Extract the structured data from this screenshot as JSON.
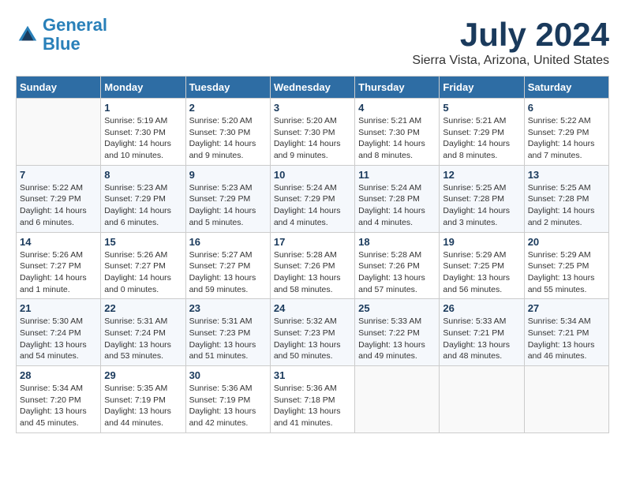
{
  "logo": {
    "line1": "General",
    "line2": "Blue"
  },
  "title": "July 2024",
  "location": "Sierra Vista, Arizona, United States",
  "days_of_week": [
    "Sunday",
    "Monday",
    "Tuesday",
    "Wednesday",
    "Thursday",
    "Friday",
    "Saturday"
  ],
  "weeks": [
    [
      {
        "day": "",
        "info": ""
      },
      {
        "day": "1",
        "info": "Sunrise: 5:19 AM\nSunset: 7:30 PM\nDaylight: 14 hours\nand 10 minutes."
      },
      {
        "day": "2",
        "info": "Sunrise: 5:20 AM\nSunset: 7:30 PM\nDaylight: 14 hours\nand 9 minutes."
      },
      {
        "day": "3",
        "info": "Sunrise: 5:20 AM\nSunset: 7:30 PM\nDaylight: 14 hours\nand 9 minutes."
      },
      {
        "day": "4",
        "info": "Sunrise: 5:21 AM\nSunset: 7:30 PM\nDaylight: 14 hours\nand 8 minutes."
      },
      {
        "day": "5",
        "info": "Sunrise: 5:21 AM\nSunset: 7:29 PM\nDaylight: 14 hours\nand 8 minutes."
      },
      {
        "day": "6",
        "info": "Sunrise: 5:22 AM\nSunset: 7:29 PM\nDaylight: 14 hours\nand 7 minutes."
      }
    ],
    [
      {
        "day": "7",
        "info": "Sunrise: 5:22 AM\nSunset: 7:29 PM\nDaylight: 14 hours\nand 6 minutes."
      },
      {
        "day": "8",
        "info": "Sunrise: 5:23 AM\nSunset: 7:29 PM\nDaylight: 14 hours\nand 6 minutes."
      },
      {
        "day": "9",
        "info": "Sunrise: 5:23 AM\nSunset: 7:29 PM\nDaylight: 14 hours\nand 5 minutes."
      },
      {
        "day": "10",
        "info": "Sunrise: 5:24 AM\nSunset: 7:29 PM\nDaylight: 14 hours\nand 4 minutes."
      },
      {
        "day": "11",
        "info": "Sunrise: 5:24 AM\nSunset: 7:28 PM\nDaylight: 14 hours\nand 4 minutes."
      },
      {
        "day": "12",
        "info": "Sunrise: 5:25 AM\nSunset: 7:28 PM\nDaylight: 14 hours\nand 3 minutes."
      },
      {
        "day": "13",
        "info": "Sunrise: 5:25 AM\nSunset: 7:28 PM\nDaylight: 14 hours\nand 2 minutes."
      }
    ],
    [
      {
        "day": "14",
        "info": "Sunrise: 5:26 AM\nSunset: 7:27 PM\nDaylight: 14 hours\nand 1 minute."
      },
      {
        "day": "15",
        "info": "Sunrise: 5:26 AM\nSunset: 7:27 PM\nDaylight: 14 hours\nand 0 minutes."
      },
      {
        "day": "16",
        "info": "Sunrise: 5:27 AM\nSunset: 7:27 PM\nDaylight: 13 hours\nand 59 minutes."
      },
      {
        "day": "17",
        "info": "Sunrise: 5:28 AM\nSunset: 7:26 PM\nDaylight: 13 hours\nand 58 minutes."
      },
      {
        "day": "18",
        "info": "Sunrise: 5:28 AM\nSunset: 7:26 PM\nDaylight: 13 hours\nand 57 minutes."
      },
      {
        "day": "19",
        "info": "Sunrise: 5:29 AM\nSunset: 7:25 PM\nDaylight: 13 hours\nand 56 minutes."
      },
      {
        "day": "20",
        "info": "Sunrise: 5:29 AM\nSunset: 7:25 PM\nDaylight: 13 hours\nand 55 minutes."
      }
    ],
    [
      {
        "day": "21",
        "info": "Sunrise: 5:30 AM\nSunset: 7:24 PM\nDaylight: 13 hours\nand 54 minutes."
      },
      {
        "day": "22",
        "info": "Sunrise: 5:31 AM\nSunset: 7:24 PM\nDaylight: 13 hours\nand 53 minutes."
      },
      {
        "day": "23",
        "info": "Sunrise: 5:31 AM\nSunset: 7:23 PM\nDaylight: 13 hours\nand 51 minutes."
      },
      {
        "day": "24",
        "info": "Sunrise: 5:32 AM\nSunset: 7:23 PM\nDaylight: 13 hours\nand 50 minutes."
      },
      {
        "day": "25",
        "info": "Sunrise: 5:33 AM\nSunset: 7:22 PM\nDaylight: 13 hours\nand 49 minutes."
      },
      {
        "day": "26",
        "info": "Sunrise: 5:33 AM\nSunset: 7:21 PM\nDaylight: 13 hours\nand 48 minutes."
      },
      {
        "day": "27",
        "info": "Sunrise: 5:34 AM\nSunset: 7:21 PM\nDaylight: 13 hours\nand 46 minutes."
      }
    ],
    [
      {
        "day": "28",
        "info": "Sunrise: 5:34 AM\nSunset: 7:20 PM\nDaylight: 13 hours\nand 45 minutes."
      },
      {
        "day": "29",
        "info": "Sunrise: 5:35 AM\nSunset: 7:19 PM\nDaylight: 13 hours\nand 44 minutes."
      },
      {
        "day": "30",
        "info": "Sunrise: 5:36 AM\nSunset: 7:19 PM\nDaylight: 13 hours\nand 42 minutes."
      },
      {
        "day": "31",
        "info": "Sunrise: 5:36 AM\nSunset: 7:18 PM\nDaylight: 13 hours\nand 41 minutes."
      },
      {
        "day": "",
        "info": ""
      },
      {
        "day": "",
        "info": ""
      },
      {
        "day": "",
        "info": ""
      }
    ]
  ]
}
